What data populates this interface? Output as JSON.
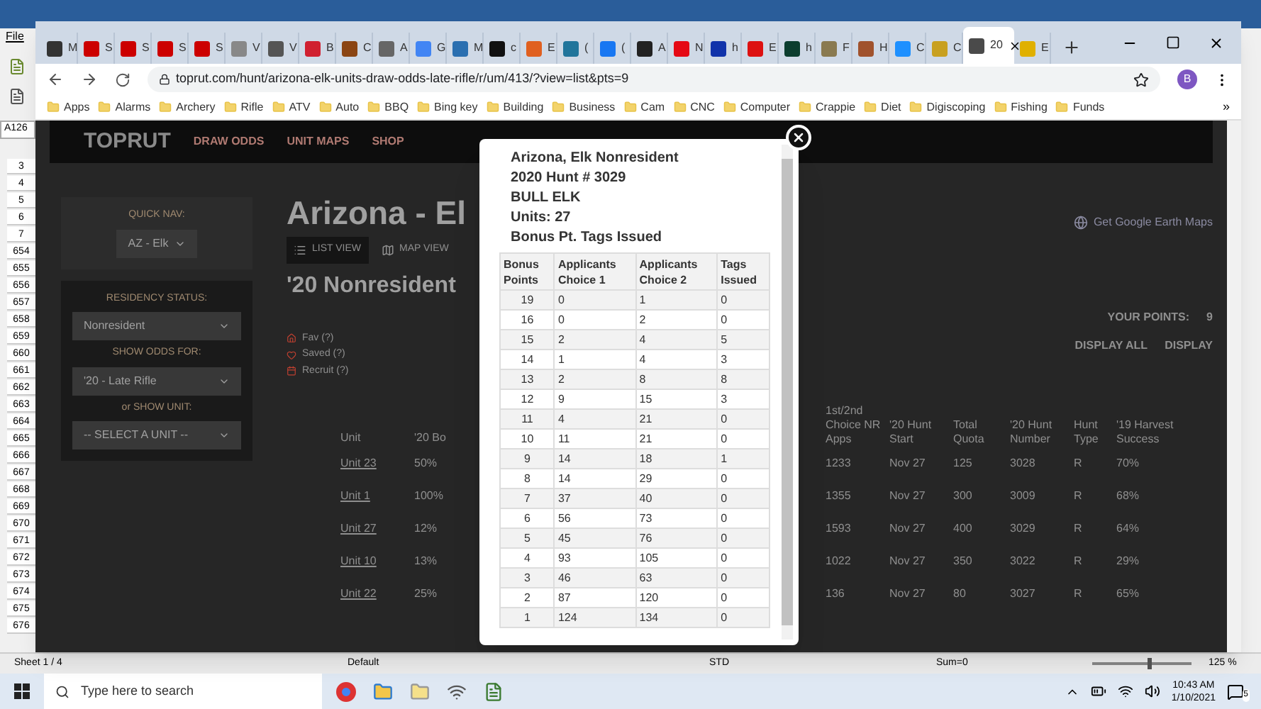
{
  "spreadsheet": {
    "menu": "File",
    "cell_ref": "A126",
    "row_numbers": [
      "3",
      "4",
      "5",
      "6",
      "7",
      "654",
      "655",
      "656",
      "657",
      "658",
      "659",
      "660",
      "661",
      "662",
      "663",
      "664",
      "665",
      "666",
      "667",
      "668",
      "669",
      "670",
      "671",
      "672",
      "673",
      "674",
      "675",
      "676"
    ],
    "status_bar": {
      "sheet": "Sheet 1 / 4",
      "style": "Default",
      "mode": "STD",
      "sum": "Sum=0",
      "zoom": "125 %",
      "zoom_slider": {
        "level": 0.55
      }
    }
  },
  "browser": {
    "tabs": [
      {
        "label": "M",
        "color": "#333333",
        "selected": false
      },
      {
        "label": "S",
        "color": "#cc0000",
        "selected": false
      },
      {
        "label": "S",
        "color": "#cc0000",
        "selected": false
      },
      {
        "label": "S",
        "color": "#cc0000",
        "selected": false
      },
      {
        "label": "S",
        "color": "#cc0000",
        "selected": false
      },
      {
        "label": "V",
        "color": "#888888",
        "selected": false
      },
      {
        "label": "V",
        "color": "#555555",
        "selected": false
      },
      {
        "label": "B",
        "color": "#d02030",
        "selected": false
      },
      {
        "label": "C",
        "color": "#8b4513",
        "selected": false
      },
      {
        "label": "A",
        "color": "#666666",
        "selected": false
      },
      {
        "label": "G",
        "color": "#4285f4",
        "selected": false
      },
      {
        "label": "M",
        "color": "#2a6fb0",
        "selected": false
      },
      {
        "label": "c",
        "color": "#111111",
        "selected": false
      },
      {
        "label": "E",
        "color": "#e06020",
        "selected": false
      },
      {
        "label": "(",
        "color": "#21759b",
        "selected": false
      },
      {
        "label": "(",
        "color": "#1877f2",
        "selected": false
      },
      {
        "label": "A",
        "color": "#222222",
        "selected": false
      },
      {
        "label": "N",
        "color": "#e50914",
        "selected": false
      },
      {
        "label": "h",
        "color": "#1133aa",
        "selected": false
      },
      {
        "label": "E",
        "color": "#dd1111",
        "selected": false
      },
      {
        "label": "h",
        "color": "#0b3d2e",
        "selected": false
      },
      {
        "label": "F",
        "color": "#8a7a50",
        "selected": false
      },
      {
        "label": "H",
        "color": "#a0522d",
        "selected": false
      },
      {
        "label": "C",
        "color": "#1e90ff",
        "selected": false
      },
      {
        "label": "C",
        "color": "#c8a020",
        "selected": false
      },
      {
        "label": "20",
        "color": "#4a4a4a",
        "selected": true
      },
      {
        "label": "E",
        "color": "#e0b000",
        "selected": false
      }
    ],
    "url": "toprut.com/hunt/arizona-elk-units-draw-odds-late-rifle/r/um/413/?view=list&pts=9",
    "profile": "B",
    "bookmarks": [
      "Apps",
      "Alarms",
      "Archery",
      "Rifle",
      "ATV",
      "Auto",
      "BBQ",
      "Bing key",
      "Building",
      "Business",
      "Cam",
      "CNC",
      "Computer",
      "Crappie",
      "Diet",
      "Digiscoping",
      "Fishing",
      "Funds"
    ],
    "more_bookmarks": "»"
  },
  "page": {
    "logo": "TOPRUT",
    "nav": [
      "DRAW ODDS",
      "UNIT MAPS",
      "SHOP"
    ],
    "sidebar": [
      {
        "label": "QUICK NAV:",
        "value": "AZ - Elk"
      },
      {
        "label": "RESIDENCY STATUS:",
        "value": "Nonresident"
      },
      {
        "label": "SHOW ODDS FOR:",
        "value": "'20 - Late Rifle"
      },
      {
        "label": "or SHOW UNIT:",
        "value": "-- SELECT A UNIT --"
      }
    ],
    "title": "Arizona - El",
    "views": [
      {
        "label": "LIST VIEW",
        "selected": true
      },
      {
        "label": "MAP VIEW",
        "selected": false
      }
    ],
    "subtitle": "'20 Nonresident",
    "earth_link": "Get Google Earth Maps",
    "legend": [
      "Fav (?)",
      "Saved (?)",
      "Recruit (?)"
    ],
    "points_label": "YOUR POINTS:",
    "points_value": "9",
    "display_all": "DISPLAY ALL",
    "display": "DISPLAY",
    "table": {
      "columns": [
        "Unit",
        "'20 Bo",
        "1st/2nd Choice NR Apps",
        "'20 Hunt Start",
        "Total Quota",
        "'20 Hunt Number",
        "Hunt Type",
        "'19 Harvest Success"
      ],
      "rows": [
        [
          "Unit 23",
          "50%",
          "1233",
          "Nov 27",
          "125",
          "3028",
          "R",
          "70%"
        ],
        [
          "Unit 1",
          "100%",
          "1355",
          "Nov 27",
          "300",
          "3009",
          "R",
          "68%"
        ],
        [
          "Unit 27",
          "12%",
          "1593",
          "Nov 27",
          "400",
          "3029",
          "R",
          "64%"
        ],
        [
          "Unit 10",
          "13%",
          "1022",
          "Nov 27",
          "350",
          "3022",
          "R",
          "29%"
        ],
        [
          "Unit 22",
          "25%",
          "136",
          "Nov 27",
          "80",
          "3027",
          "R",
          "65%"
        ]
      ]
    }
  },
  "modal": {
    "lines": [
      "Arizona, Elk Nonresident",
      "2020 Hunt # 3029",
      "BULL ELK",
      "Units: 27",
      "Bonus Pt. Tags Issued"
    ],
    "columns": [
      "Bonus Points",
      "Applicants Choice 1",
      "Applicants Choice 2",
      "Tags Issued"
    ],
    "rows": [
      [
        "19",
        "0",
        "1",
        "0"
      ],
      [
        "16",
        "0",
        "2",
        "0"
      ],
      [
        "15",
        "2",
        "4",
        "5"
      ],
      [
        "14",
        "1",
        "4",
        "3"
      ],
      [
        "13",
        "2",
        "8",
        "8"
      ],
      [
        "12",
        "9",
        "15",
        "3"
      ],
      [
        "11",
        "4",
        "21",
        "0"
      ],
      [
        "10",
        "11",
        "21",
        "0"
      ],
      [
        "9",
        "14",
        "18",
        "1"
      ],
      [
        "8",
        "14",
        "29",
        "0"
      ],
      [
        "7",
        "37",
        "40",
        "0"
      ],
      [
        "6",
        "56",
        "73",
        "0"
      ],
      [
        "5",
        "45",
        "76",
        "0"
      ],
      [
        "4",
        "93",
        "105",
        "0"
      ],
      [
        "3",
        "46",
        "63",
        "0"
      ],
      [
        "2",
        "87",
        "120",
        "0"
      ],
      [
        "1",
        "124",
        "134",
        "0"
      ]
    ]
  },
  "taskbar": {
    "search_placeholder": "Type here to search",
    "time": "10:43 AM",
    "date": "1/10/2021",
    "notifications": "5"
  }
}
